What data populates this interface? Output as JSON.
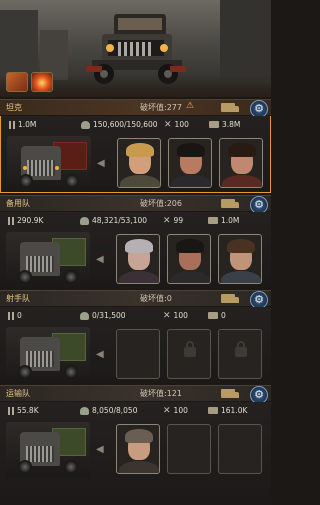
{
  "squads": [
    {
      "name": "坦克",
      "damage": "破坏值:277",
      "warning": "⚠",
      "ammo": "1.0M",
      "hp": "150,600/150,600",
      "tools": "100",
      "load": "3.8M",
      "active": true,
      "heroes": [
        "hero-blond-soldier",
        "hero-red-eyes",
        "hero-bearded-brawler"
      ]
    },
    {
      "name": "备用队",
      "damage": "破坏值:206",
      "warning": "",
      "ammo": "290.9K",
      "hp": "48,321/53,100",
      "tools": "99",
      "load": "1.0M",
      "active": false,
      "heroes": [
        "hero-silver-haired-woman",
        "hero-dark-agent",
        "hero-brown-haired-man"
      ]
    },
    {
      "name": "射手队",
      "damage": "破坏值:0",
      "warning": "",
      "ammo": "0",
      "hp": "0/31,500",
      "tools": "100",
      "load": "0",
      "active": false,
      "heroes": [
        "empty",
        "locked",
        "locked"
      ]
    },
    {
      "name": "运输队",
      "damage": "破坏值:121",
      "warning": "",
      "ammo": "55.8K",
      "hp": "8,050/8,050",
      "tools": "100",
      "load": "161.0K",
      "active": false,
      "heroes": [
        "hero-gray-haired-man",
        "empty",
        "empty"
      ]
    }
  ],
  "colors": {
    "accent": "#e39a2e",
    "header_text": "#e8c78a"
  }
}
